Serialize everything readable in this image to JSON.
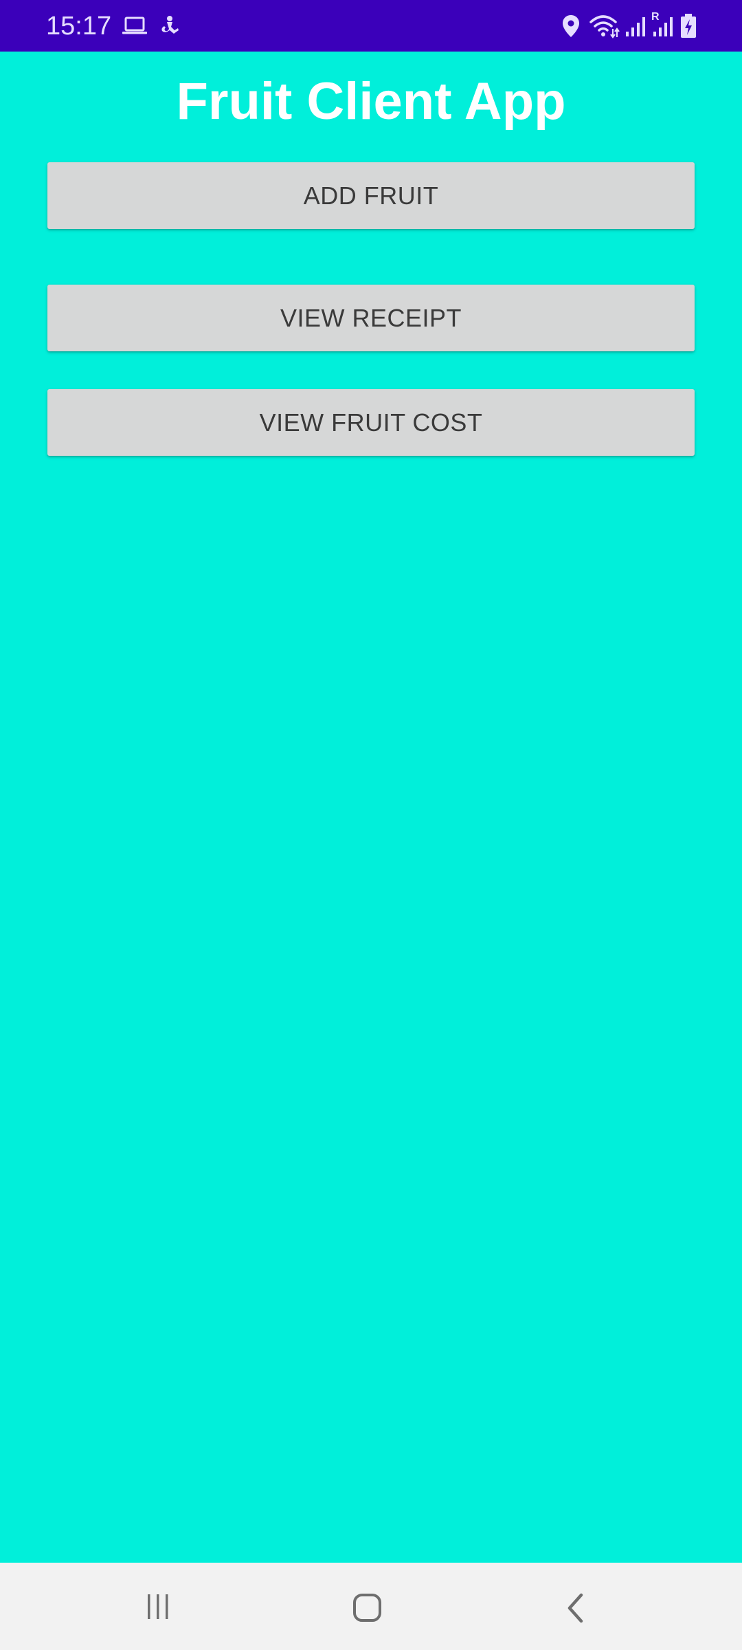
{
  "status_bar": {
    "time": "15:17",
    "background_color": "#3B00BA",
    "left_icons": [
      "laptop-icon",
      "accessibility-icon"
    ],
    "right_icons": [
      "location-icon",
      "wifi-icon",
      "signal-icon",
      "signal-roaming-icon",
      "battery-charging-icon"
    ],
    "roaming_label": "R"
  },
  "app": {
    "title": "Fruit Client App",
    "background_color": "#01EFDA"
  },
  "buttons": {
    "add_fruit": "ADD FRUIT",
    "view_receipt": "VIEW RECEIPT",
    "view_fruit_cost": "VIEW FRUIT COST"
  },
  "nav_bar": {
    "icons": [
      "recent-apps-icon",
      "home-icon",
      "back-icon"
    ]
  }
}
